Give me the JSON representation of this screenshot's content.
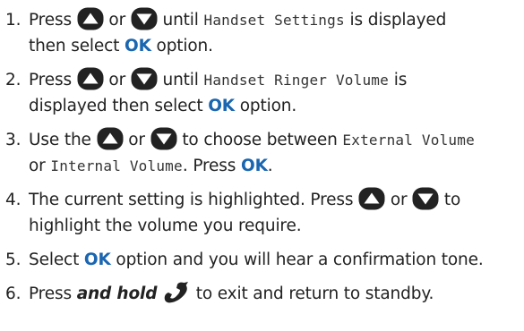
{
  "steps": [
    {
      "number": "1.",
      "text_press": "Press",
      "text_or": "or",
      "text_until": "until",
      "display": "Handset Settings",
      "text_is_displayed": "is displayed",
      "text_then_select": "then select",
      "ok": "OK",
      "text_option": "option."
    },
    {
      "number": "2.",
      "text_press": "Press",
      "text_or": "or",
      "text_until": "until",
      "display": "Handset Ringer Volume",
      "text_is": "is",
      "text_displayed_then_select": "displayed then select",
      "ok": "OK",
      "text_option": "option."
    },
    {
      "number": "3.",
      "text_use_the": "Use the",
      "text_or": "or",
      "text_to_choose": "to choose between",
      "display_external": "External Volume",
      "text_or2": "or",
      "display_internal": "Internal Volume",
      "text_press": ". Press",
      "ok": "OK",
      "text_end": "."
    },
    {
      "number": "4.",
      "text_highlighted": "The current setting is highlighted. Press",
      "text_or": "or",
      "text_to": "to",
      "text_line2": "highlight the volume you require."
    },
    {
      "number": "5.",
      "text_select": "Select",
      "ok": "OK",
      "text_rest": "option and you will hear a confirmation tone."
    },
    {
      "number": "6.",
      "text_press": "Press",
      "emph": "and hold",
      "text_rest": "to exit and return to standby."
    }
  ],
  "icons": {
    "up": "up-arrow-icon",
    "down": "down-arrow-icon",
    "end_call": "end-call-handset-icon"
  },
  "colors": {
    "ok": "#1a66b0",
    "text": "#222222",
    "icon": "#222222"
  }
}
